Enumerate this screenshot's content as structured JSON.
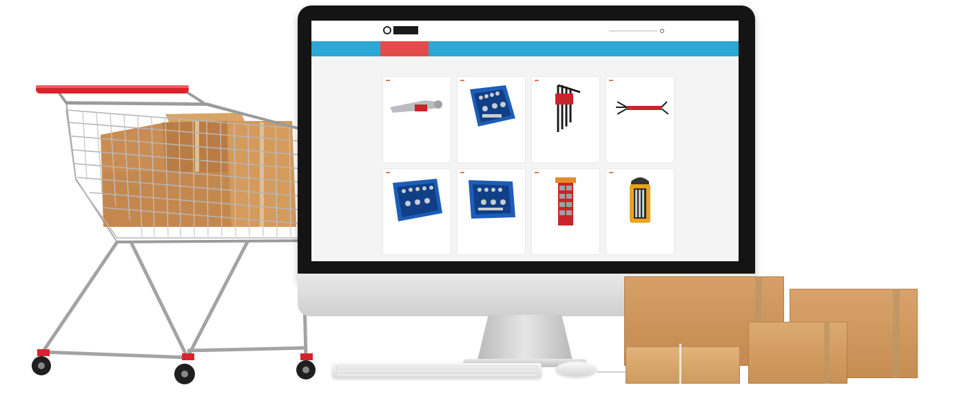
{
  "scene": {
    "description_labels": {
      "monitor": "desktop-monitor",
      "cart": "shopping-cart",
      "boxes": "cardboard-boxes"
    }
  },
  "colors": {
    "nav_blue": "#2ba8d6",
    "nav_active_red": "#e34a4a",
    "badge_orange": "#e4794a",
    "cart_handle_red": "#d7242c",
    "cardboard": "#c98e52"
  },
  "site": {
    "nav": [
      {
        "label": ""
      },
      {
        "label": ""
      },
      {
        "label": ""
      },
      {
        "label": ""
      }
    ],
    "section_title": "",
    "products": [
      {
        "icon": "ratchet-wrench",
        "badge": "",
        "name": "",
        "price": ""
      },
      {
        "icon": "socket-set-case",
        "badge": "",
        "name": "",
        "price": ""
      },
      {
        "icon": "hex-key-set",
        "badge": "",
        "name": "",
        "price": ""
      },
      {
        "icon": "folding-hex-key",
        "badge": "",
        "name": "",
        "price": ""
      },
      {
        "icon": "socket-set-case",
        "badge": "",
        "name": "",
        "price": ""
      },
      {
        "icon": "socket-set-case",
        "badge": "",
        "name": "",
        "price": ""
      },
      {
        "icon": "socket-rail",
        "badge": "",
        "name": "",
        "price": ""
      },
      {
        "icon": "bit-set-holder",
        "badge": "",
        "name": "",
        "price": ""
      }
    ]
  }
}
